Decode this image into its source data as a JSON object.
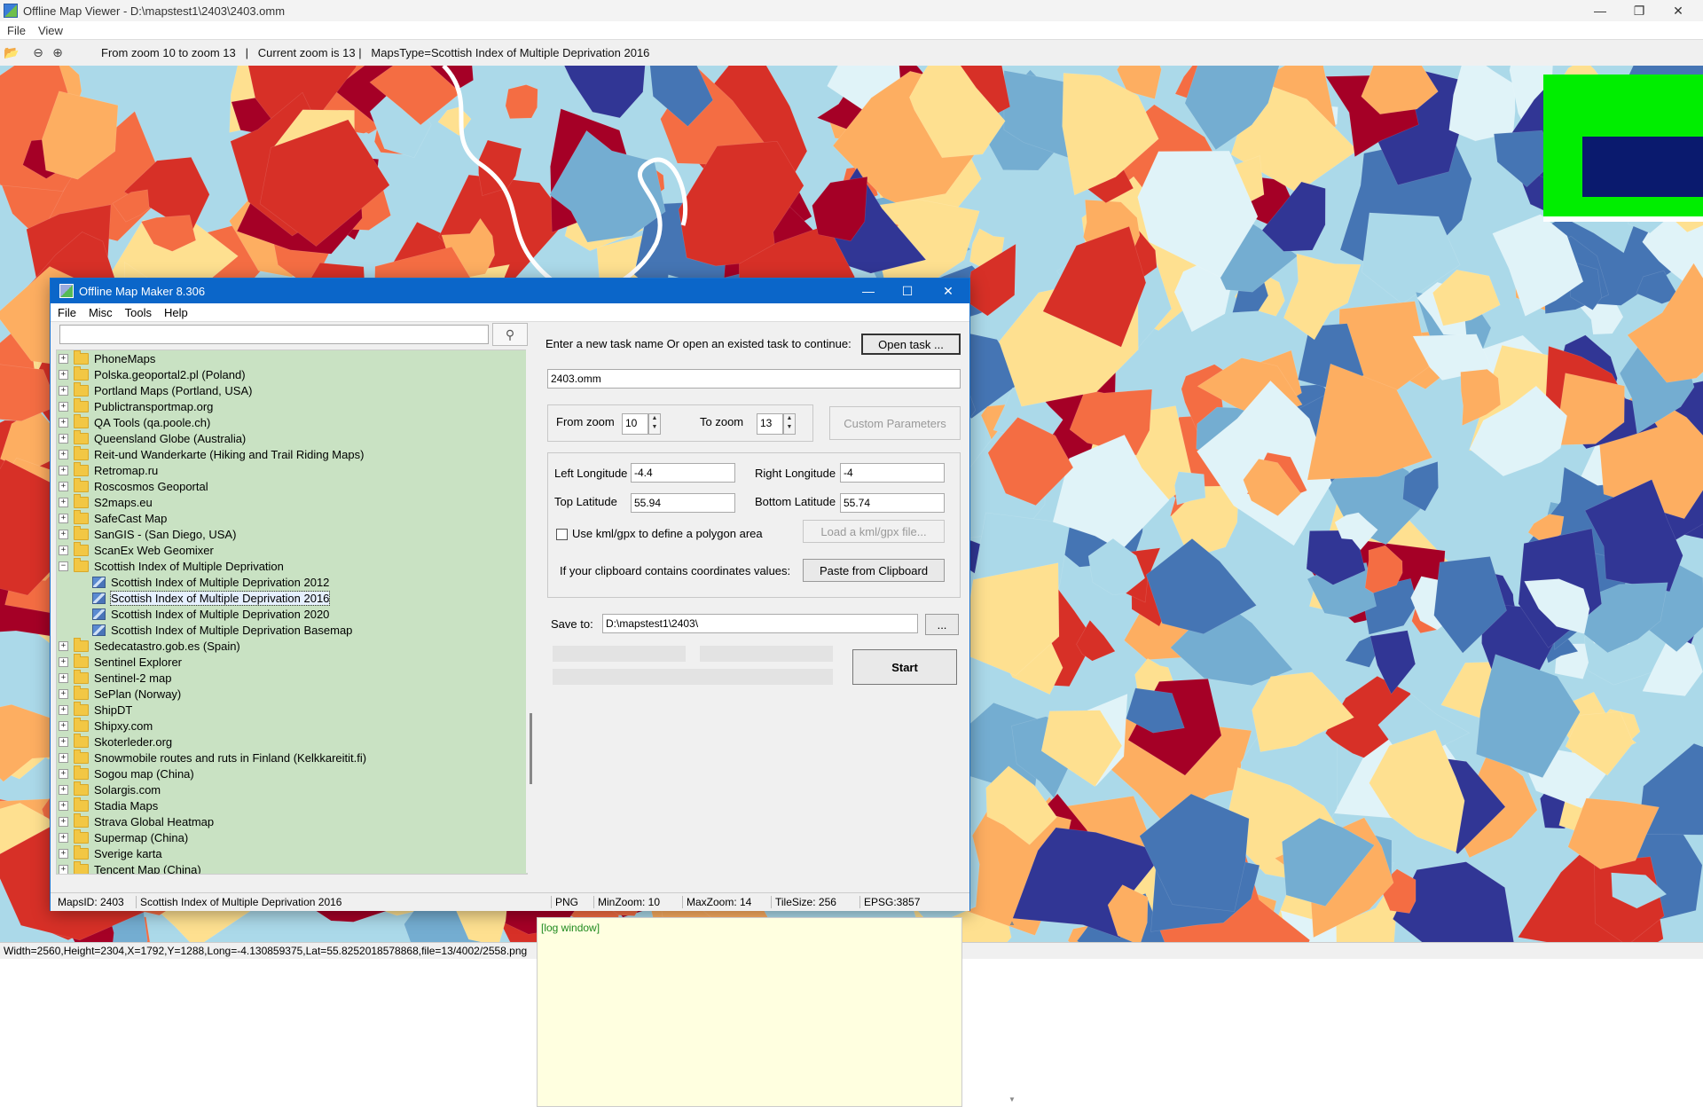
{
  "window": {
    "title": "Offline Map Viewer - D:\\mapstest1\\2403\\2403.omm",
    "menu": [
      "File",
      "View"
    ],
    "toolbar_text": "From zoom 10 to zoom 13   |   Current zoom is 13 |   MapsType=Scottish Index of Multiple Deprivation 2016",
    "status": "Width=2560,Height=2304,X=1792,Y=1288,Long=-4.130859375,Lat=55.8252018578868,file=13/4002/2558.png"
  },
  "dialog": {
    "title": "Offline Map Maker 8.306",
    "menu": [
      "File",
      "Misc",
      "Tools",
      "Help"
    ],
    "search_value": "",
    "tree": [
      {
        "label": "PhoneMaps",
        "kind": "folder"
      },
      {
        "label": "Polska.geoportal2.pl (Poland)",
        "kind": "folder"
      },
      {
        "label": "Portland Maps (Portland, USA)",
        "kind": "folder"
      },
      {
        "label": "Publictransportmap.org",
        "kind": "folder"
      },
      {
        "label": "QA Tools (qa.poole.ch)",
        "kind": "folder"
      },
      {
        "label": "Queensland Globe (Australia)",
        "kind": "folder"
      },
      {
        "label": "Reit-und Wanderkarte (Hiking and Trail Riding Maps)",
        "kind": "folder"
      },
      {
        "label": "Retromap.ru",
        "kind": "folder"
      },
      {
        "label": "Roscosmos Geoportal",
        "kind": "folder"
      },
      {
        "label": "S2maps.eu",
        "kind": "folder"
      },
      {
        "label": "SafeCast Map",
        "kind": "folder"
      },
      {
        "label": "SanGIS - (San Diego, USA)",
        "kind": "folder"
      },
      {
        "label": "ScanEx Web Geomixer",
        "kind": "folder"
      },
      {
        "label": "Scottish Index of Multiple Deprivation",
        "kind": "open-folder"
      },
      {
        "label": "Scottish Index of Multiple Deprivation 2012",
        "kind": "map"
      },
      {
        "label": "Scottish Index of Multiple Deprivation 2016",
        "kind": "map",
        "selected": true
      },
      {
        "label": "Scottish Index of Multiple Deprivation 2020",
        "kind": "map"
      },
      {
        "label": "Scottish Index of Multiple Deprivation Basemap",
        "kind": "map"
      },
      {
        "label": "Sedecatastro.gob.es (Spain)",
        "kind": "folder"
      },
      {
        "label": "Sentinel Explorer",
        "kind": "folder"
      },
      {
        "label": "Sentinel-2 map",
        "kind": "folder"
      },
      {
        "label": "SePlan (Norway)",
        "kind": "folder"
      },
      {
        "label": "ShipDT",
        "kind": "folder"
      },
      {
        "label": "Shipxy.com",
        "kind": "folder"
      },
      {
        "label": "Skoterleder.org",
        "kind": "folder"
      },
      {
        "label": "Snowmobile routes and ruts in Finland (Kelkkareitit.fi)",
        "kind": "folder"
      },
      {
        "label": "Sogou map (China)",
        "kind": "folder"
      },
      {
        "label": "Solargis.com",
        "kind": "folder"
      },
      {
        "label": "Stadia Maps",
        "kind": "folder"
      },
      {
        "label": "Strava Global Heatmap",
        "kind": "folder"
      },
      {
        "label": "Supermap (China)",
        "kind": "folder"
      },
      {
        "label": "Sverige karta",
        "kind": "folder"
      },
      {
        "label": "Tencent Map (China)",
        "kind": "folder"
      }
    ],
    "task_prompt": "Enter a new task name Or open an existed task to continue:",
    "open_task_label": "Open task ...",
    "task_name": "2403.omm",
    "from_zoom_label": "From zoom",
    "from_zoom": "10",
    "to_zoom_label": "To zoom",
    "to_zoom": "13",
    "custom_params_label": "Custom Parameters",
    "left_lon_label": "Left Longitude",
    "left_lon": "-4.4",
    "right_lon_label": "Right Longitude",
    "right_lon": "-4",
    "top_lat_label": "Top Latitude",
    "top_lat": "55.94",
    "bottom_lat_label": "Bottom Latitude",
    "bottom_lat": "55.74",
    "kml_checkbox_label": "Use kml/gpx to define a polygon area",
    "kml_checked": false,
    "load_kml_label": "Load a kml/gpx file...",
    "clipboard_prompt": "If your clipboard contains coordinates values:",
    "paste_label": "Paste from Clipboard",
    "save_to_label": "Save to:",
    "save_to": "D:\\mapstest1\\2403\\",
    "browse_label": "...",
    "start_label": "Start",
    "log_text": "[log window]",
    "status": {
      "maps_id": "MapsID: 2403",
      "maps_name": "Scottish Index of Multiple Deprivation 2016",
      "format": "PNG",
      "min_zoom": "MinZoom: 10",
      "max_zoom": "MaxZoom: 14",
      "tile_size": "TileSize: 256",
      "epsg": "EPSG:3857"
    }
  },
  "colors": {
    "map_palette": [
      "#a50026",
      "#d73027",
      "#f46d43",
      "#fdae61",
      "#fee090",
      "#e0f3f8",
      "#abd9e9",
      "#74add1",
      "#4575b4",
      "#313695"
    ],
    "minimap_green": "#00ee00",
    "minimap_blue": "#0a1a6e",
    "tree_bg": "#c9e2c3",
    "log_bg": "#ffffe0",
    "dialog_title_bg": "#0b66c9"
  }
}
